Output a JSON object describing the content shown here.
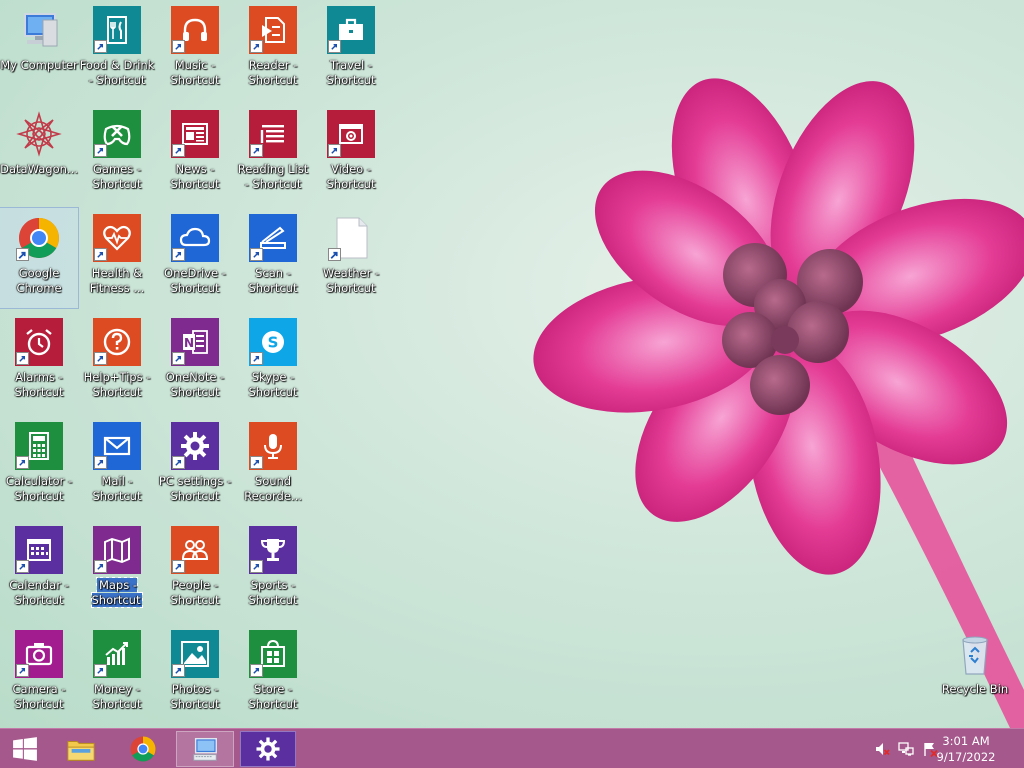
{
  "icons": [
    {
      "label": "My Computer",
      "name": "my-computer"
    },
    {
      "label": "DataWagon...",
      "name": "datawagon"
    },
    {
      "label": "Google Chrome",
      "name": "google-chrome"
    },
    {
      "label": "Alarms - Shortcut",
      "name": "alarms-shortcut"
    },
    {
      "label": "Calculator - Shortcut",
      "name": "calculator-shortcut"
    },
    {
      "label": "Calendar - Shortcut",
      "name": "calendar-shortcut"
    },
    {
      "label": "Camera - Shortcut",
      "name": "camera-shortcut"
    },
    {
      "label": "Food & Drink - Shortcut",
      "name": "food-drink-shortcut"
    },
    {
      "label": "Games - Shortcut",
      "name": "games-shortcut"
    },
    {
      "label": "Health & Fitness ...",
      "name": "health-fitness-shortcut"
    },
    {
      "label": "Help+Tips - Shortcut",
      "name": "help-tips-shortcut"
    },
    {
      "label": "Mail - Shortcut",
      "name": "mail-shortcut"
    },
    {
      "label": "Maps - Shortcut",
      "name": "maps-shortcut"
    },
    {
      "label": "Money - Shortcut",
      "name": "money-shortcut"
    },
    {
      "label": "Music - Shortcut",
      "name": "music-shortcut"
    },
    {
      "label": "News - Shortcut",
      "name": "news-shortcut"
    },
    {
      "label": "OneDrive - Shortcut",
      "name": "onedrive-shortcut"
    },
    {
      "label": "OneNote - Shortcut",
      "name": "onenote-shortcut"
    },
    {
      "label": "PC settings - Shortcut",
      "name": "pc-settings-shortcut"
    },
    {
      "label": "People - Shortcut",
      "name": "people-shortcut"
    },
    {
      "label": "Photos - Shortcut",
      "name": "photos-shortcut"
    },
    {
      "label": "Reader - Shortcut",
      "name": "reader-shortcut"
    },
    {
      "label": "Reading List - Shortcut",
      "name": "reading-list-shortcut"
    },
    {
      "label": "Scan - Shortcut",
      "name": "scan-shortcut"
    },
    {
      "label": "Skype - Shortcut",
      "name": "skype-shortcut"
    },
    {
      "label": "Sound Recorde...",
      "name": "sound-recorder-shortcut"
    },
    {
      "label": "Sports - Shortcut",
      "name": "sports-shortcut"
    },
    {
      "label": "Store - Shortcut",
      "name": "store-shortcut"
    },
    {
      "label": "Travel - Shortcut",
      "name": "travel-shortcut"
    },
    {
      "label": "Video - Shortcut",
      "name": "video-shortcut"
    },
    {
      "label": "Weather - Shortcut",
      "name": "weather-shortcut"
    },
    {
      "label": "Recycle Bin",
      "name": "recycle-bin"
    }
  ],
  "taskbar": {
    "start": "windows-logo-icon",
    "pinned": [
      "file-explorer-icon",
      "chrome-icon",
      "remote-desktop-icon",
      "pc-settings-icon"
    ]
  },
  "tray": {
    "icons": [
      "speaker-muted-icon",
      "network-icon",
      "action-center-flag-icon"
    ],
    "time": "3:01 AM",
    "date": "9/17/2022"
  },
  "colors": {
    "taskbar": "#a4588c",
    "selection": "#3a72c9",
    "tile_green": "#1e8f3e",
    "tile_red": "#b51d3a",
    "tile_orange": "#dd4b22",
    "tile_purple": "#5b2fa0",
    "tile_blue": "#1f66d6",
    "tile_teal": "#0f8a95"
  }
}
